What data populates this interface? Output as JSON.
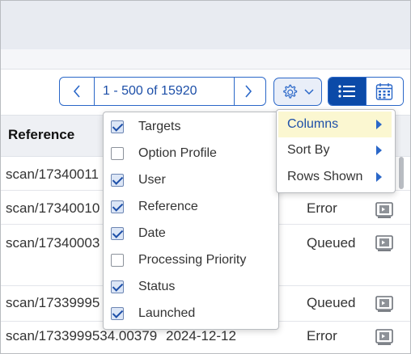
{
  "pager": {
    "range": "1 - 500 of 15920"
  },
  "table": {
    "header_reference": "Reference",
    "rows": [
      {
        "reference": "scan/17340011",
        "status": ""
      },
      {
        "reference": "scan/17340010",
        "status": "Error"
      },
      {
        "reference": "scan/17340003",
        "status": "Queued"
      },
      {
        "reference": "scan/17339995",
        "status": "Queued"
      },
      {
        "reference": "scan/1733999534.00379",
        "date": "2024-12-12",
        "status": "Error"
      }
    ]
  },
  "column_menu": {
    "items": [
      {
        "label": "Targets",
        "checked": true
      },
      {
        "label": "Option Profile",
        "checked": false
      },
      {
        "label": "User",
        "checked": true
      },
      {
        "label": "Reference",
        "checked": true
      },
      {
        "label": "Date",
        "checked": true
      },
      {
        "label": "Processing Priority",
        "checked": false
      },
      {
        "label": "Status",
        "checked": true
      },
      {
        "label": "Launched",
        "checked": true
      }
    ]
  },
  "settings_menu": {
    "items": [
      {
        "label": "Columns",
        "highlighted": true
      },
      {
        "label": "Sort By",
        "highlighted": false
      },
      {
        "label": "Rows Shown",
        "highlighted": false
      }
    ]
  },
  "colors": {
    "accent": "#2a67c8",
    "active_toggle": "#0b4aa8",
    "menu_highlight": "#fbf7d1"
  },
  "icons": [
    "chevron-left-icon",
    "chevron-right-icon",
    "gear-icon",
    "chevron-down-icon",
    "list-view-icon",
    "calendar-view-icon",
    "view-report-icon"
  ]
}
